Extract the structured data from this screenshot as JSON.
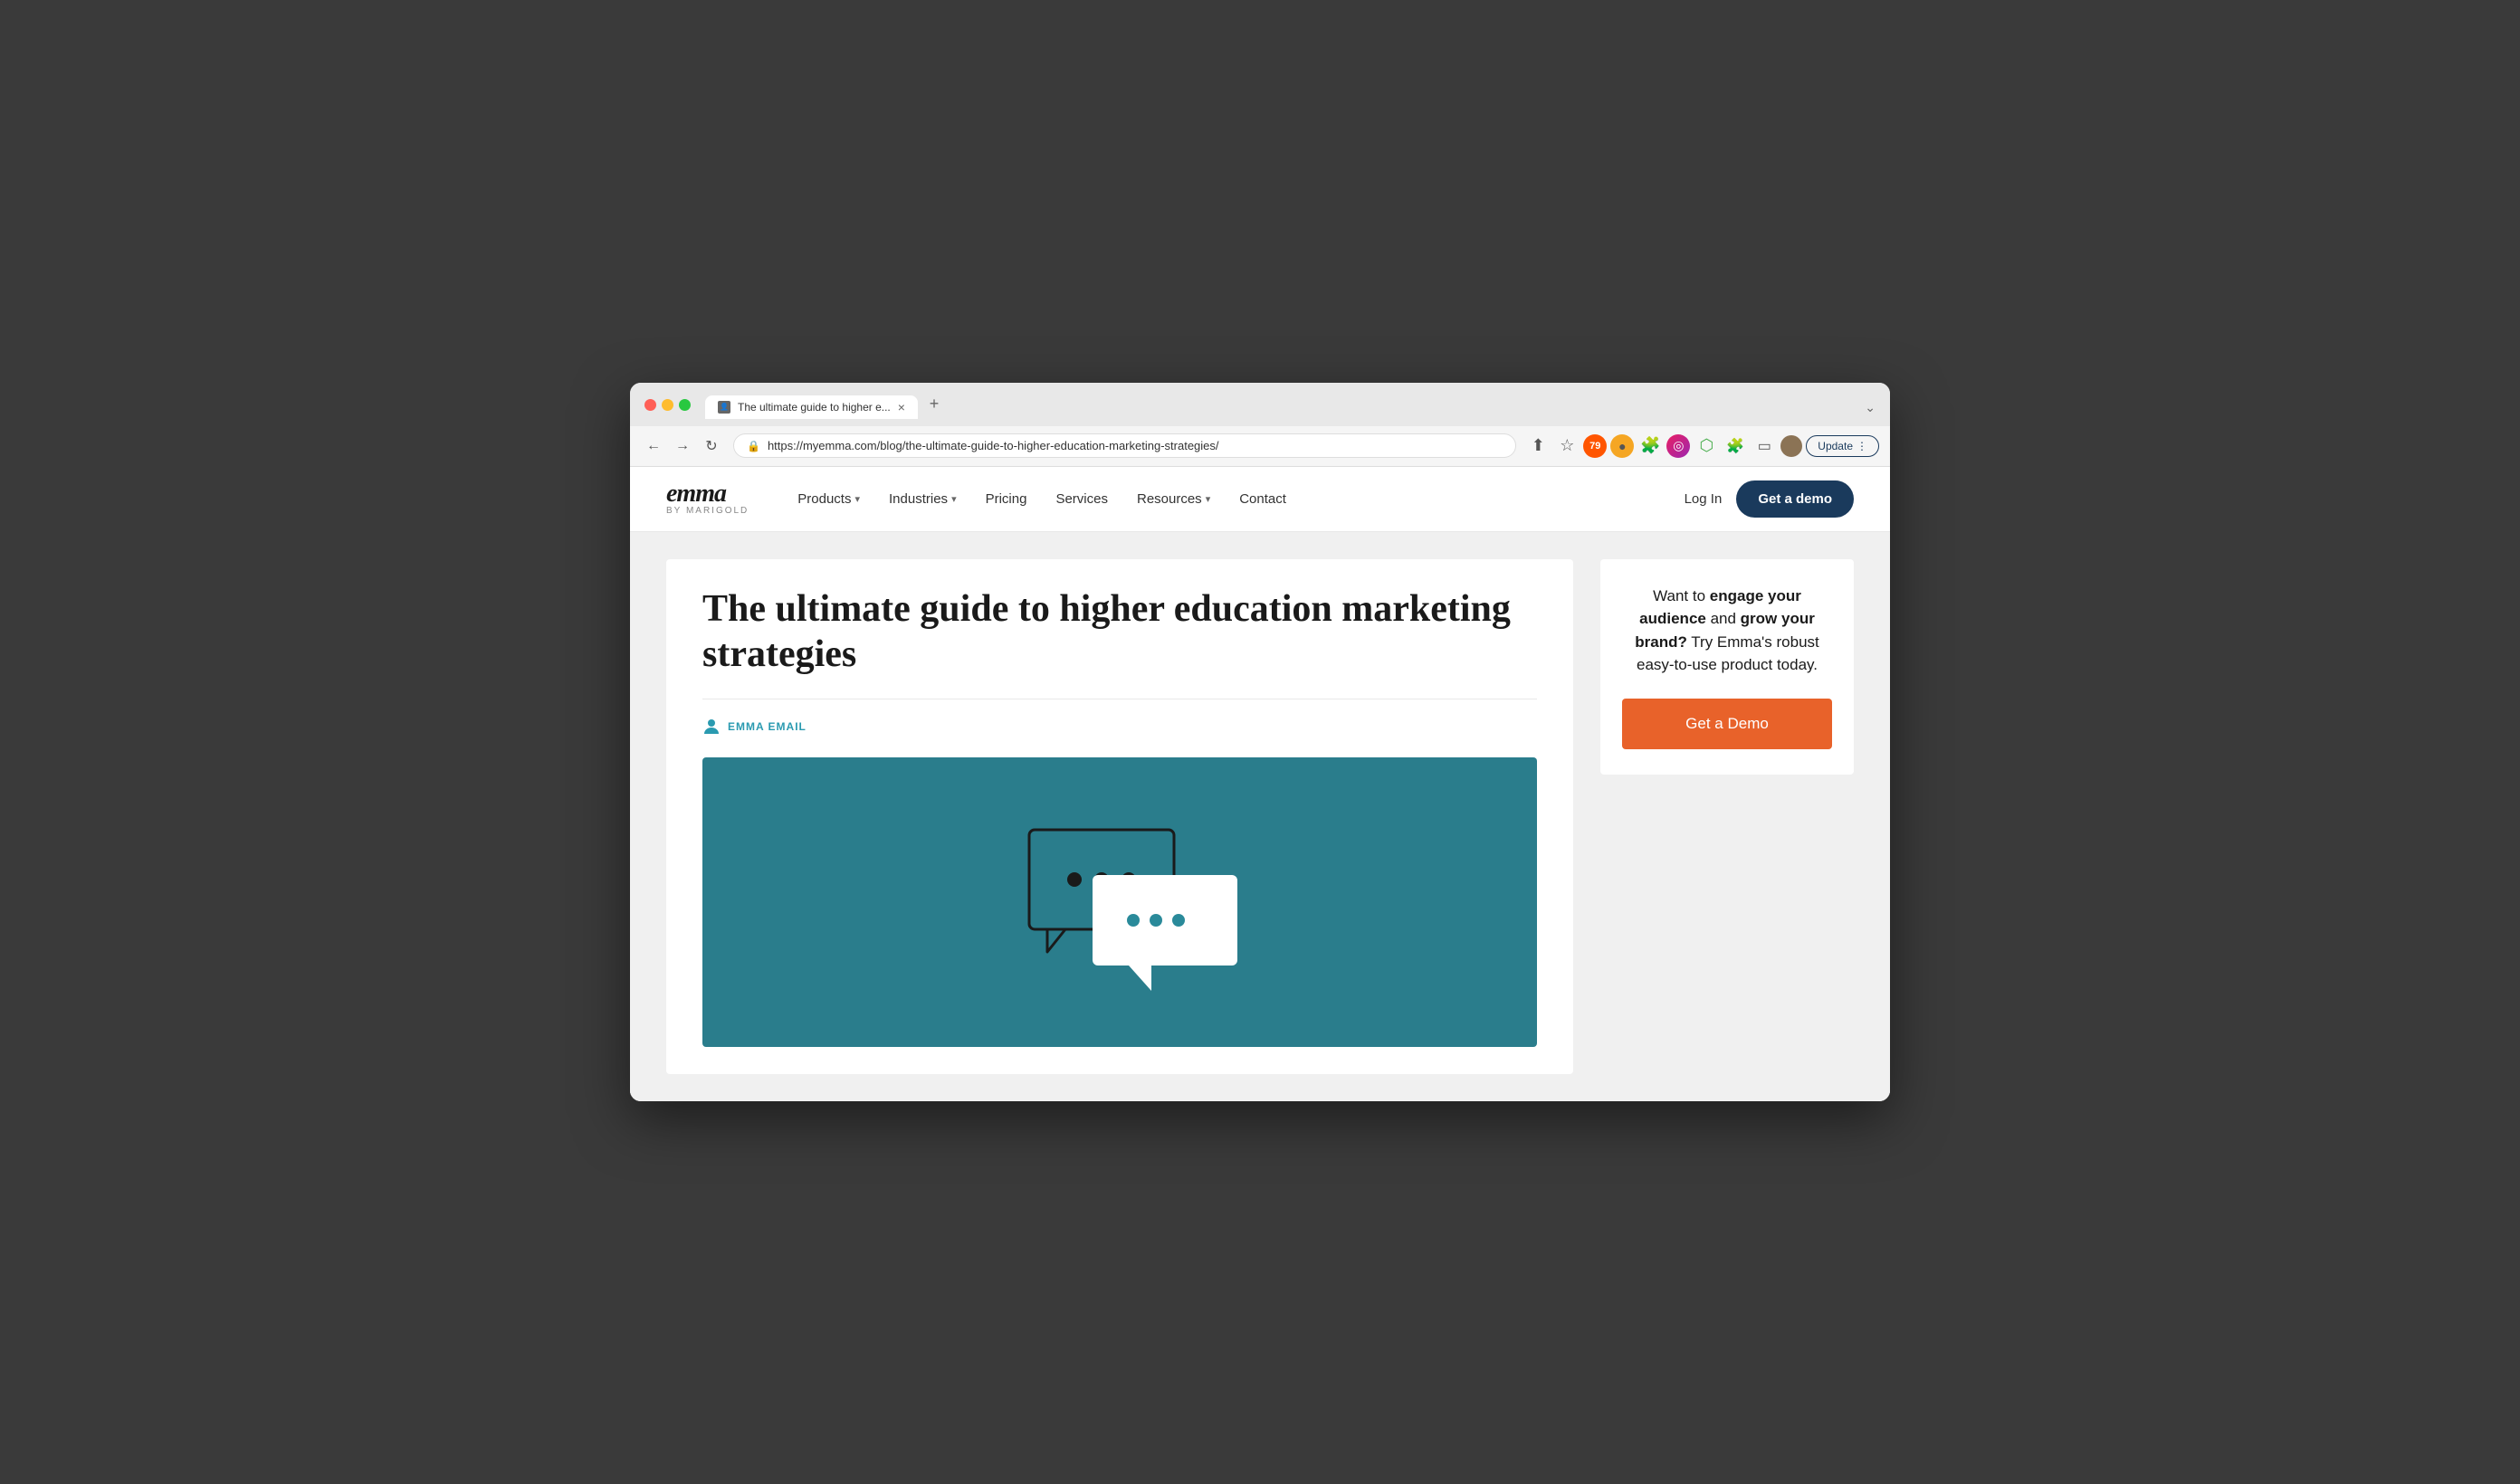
{
  "browser": {
    "tab": {
      "title": "The ultimate guide to higher e...",
      "favicon": "👤",
      "close": "×"
    },
    "new_tab": "+",
    "url": "https://myemma.com/blog/the-ultimate-guide-to-higher-education-marketing-strategies/",
    "update_button": "Update",
    "chevron": "⌄"
  },
  "nav": {
    "logo_emma": "emma",
    "logo_by": "by MARIGOLD",
    "products": "Products",
    "industries": "Industries",
    "pricing": "Pricing",
    "services": "Services",
    "resources": "Resources",
    "contact": "Contact",
    "login": "Log In",
    "get_demo": "Get a demo"
  },
  "article": {
    "title": "The ultimate guide to higher education marketing strategies",
    "author_label": "EMMA EMAIL",
    "image_alt": "Higher education marketing illustration with chat bubbles"
  },
  "sidebar": {
    "text_part1": "Want to ",
    "text_bold1": "engage your audience",
    "text_part2": " and ",
    "text_bold2": "grow your brand?",
    "text_part3": " Try Emma's robust easy-to-use product today.",
    "cta_label": "Get a Demo"
  }
}
